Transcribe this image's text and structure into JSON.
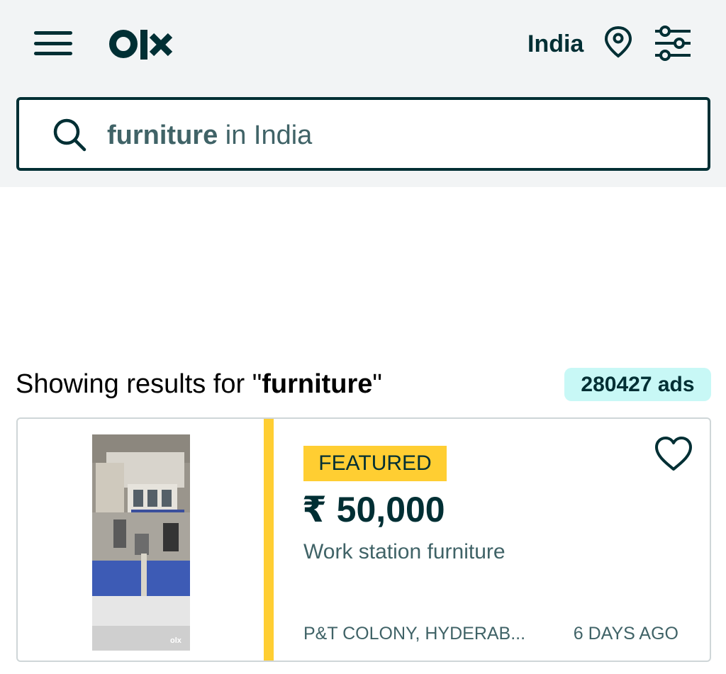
{
  "header": {
    "logo": "olx",
    "location": "India",
    "icons": {
      "menu": "hamburger-icon",
      "pin": "location-pin-icon",
      "filter": "filter-sliders-icon"
    }
  },
  "search": {
    "query": "furniture",
    "suffix": " in India",
    "icon": "search-icon"
  },
  "results": {
    "prefix": "Showing results for \"",
    "query": "furniture",
    "suffix": "\"",
    "count_label": "280427 ads"
  },
  "listing": {
    "featured_label": "FEATURED",
    "price": "₹ 50,000",
    "title": "Work station furniture",
    "location": "P&T COLONY, HYDERAB...",
    "date": "6 DAYS AGO",
    "thumb_watermark": "olx",
    "colors": {
      "featured": "#ffce32",
      "text": "#002f34",
      "muted": "#406367"
    }
  }
}
